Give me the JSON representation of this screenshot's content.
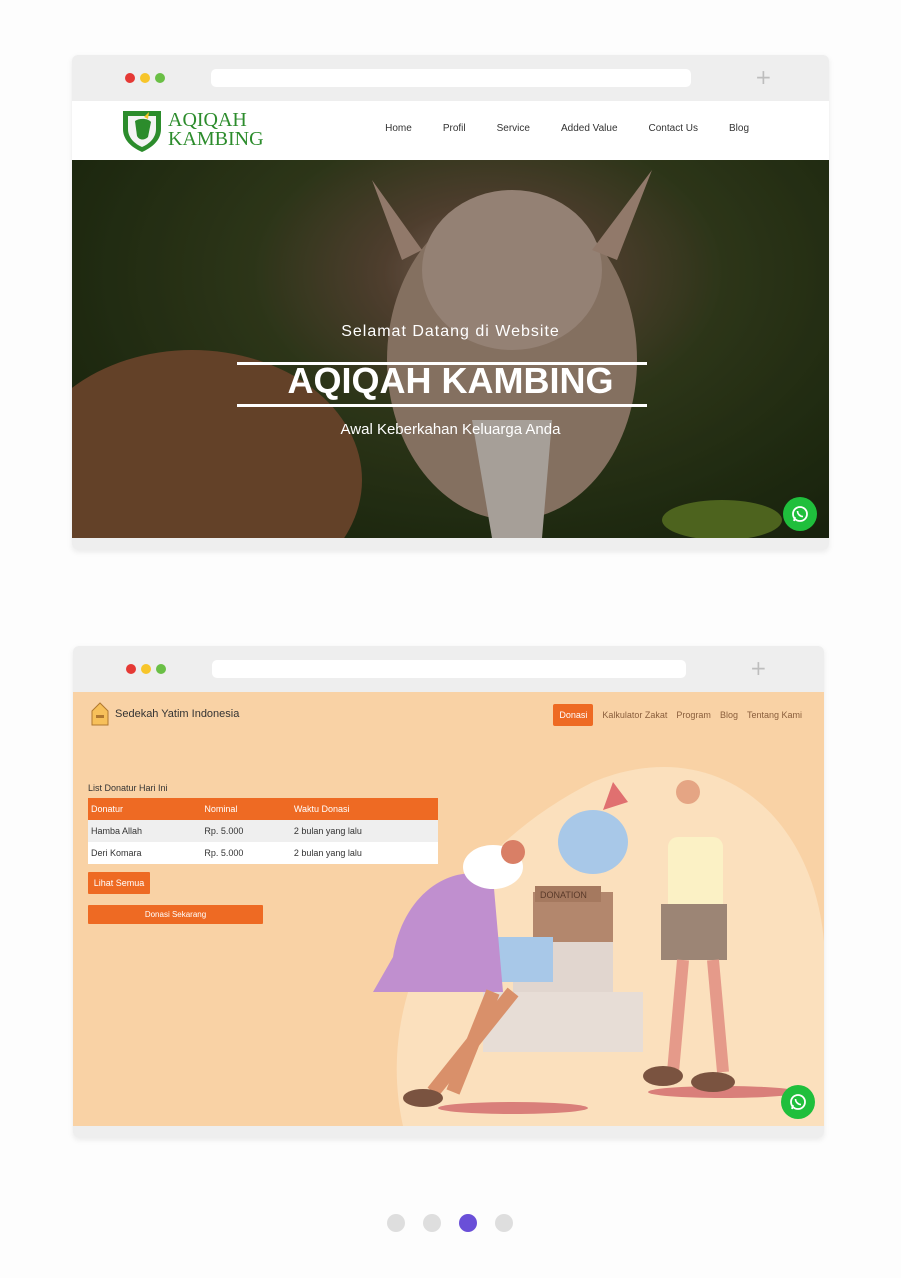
{
  "colors": {
    "dot_red": "#e53935",
    "dot_yellow": "#f7c52a",
    "dot_green": "#6abf45",
    "whatsapp": "#1fbf3c",
    "accent_orange": "#ee6a23",
    "pager_active": "#6a4fd8"
  },
  "card1": {
    "logo": {
      "line1": "AQIQAH",
      "line2": "KAMBING"
    },
    "menu": [
      "Home",
      "Profil",
      "Service",
      "Added Value",
      "Contact Us",
      "Blog"
    ],
    "hero": {
      "subtitle": "Selamat Datang di Website",
      "title": "AQIQAH KAMBING",
      "tagline": "Awal Keberkahan Keluarga Anda"
    }
  },
  "card2": {
    "brand": "Sedekah Yatim Indonesia",
    "menu": [
      "Donasi",
      "Kalkulator Zakat",
      "Program",
      "Blog",
      "Tentang Kami"
    ],
    "list_title": "List Donatur Hari Ini",
    "table": {
      "headers": [
        "Donatur",
        "Nominal",
        "Waktu Donasi"
      ],
      "rows": [
        [
          "Hamba Allah",
          "Rp. 5.000",
          "2 bulan yang lalu"
        ],
        [
          "Deri Komara",
          "Rp. 5.000",
          "2 bulan yang lalu"
        ]
      ]
    },
    "btn_lihat": "Lihat Semua",
    "btn_donasi": "Donasi Sekarang",
    "illustration_box_text": "DONATION"
  },
  "pager": {
    "count": 4,
    "active_index": 2
  }
}
